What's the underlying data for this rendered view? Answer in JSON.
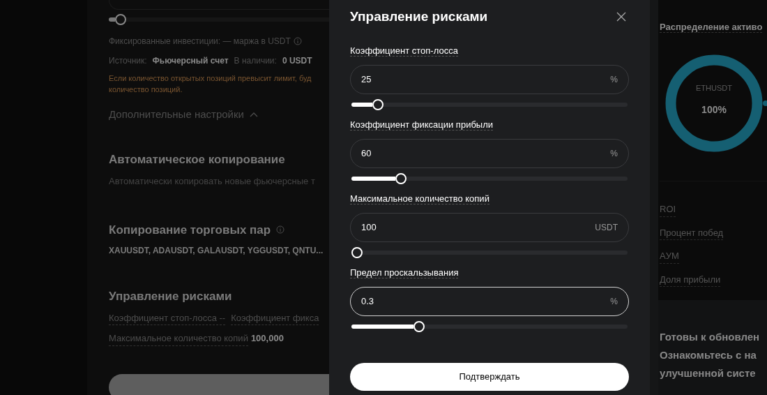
{
  "background": {
    "top_slider": {
      "level": 0.03
    },
    "investment_line": "Фиксированные инвестиции: — маржа в USDT",
    "source_label": "Источник:",
    "source_value": "Фьючерсный счет",
    "available_label": "В наличии:",
    "available_value": "0 USDT",
    "warning": "Если количество открытых позиций превысит лимит, буд\nколичество позиций.",
    "advanced_settings": {
      "label": "Дополнительные настройки",
      "expanded": true
    },
    "auto_copy": {
      "title": "Автоматическое копирование",
      "description": "Автоматически копировать новые фьючерсные т"
    },
    "pairs": {
      "title": "Копирование торговых пар",
      "value": "XAUUSDT, ADAUSDT, GALAUSDT, YGGUSDT, QNTU..."
    },
    "risk": {
      "title": "Управление рисками",
      "stop_loss": "Коэффициент стоп-лосса --",
      "take_profit": "Коэффициент фикса",
      "max_copies_label": "Максимальное количество копий",
      "max_copies_value": "100,000"
    }
  },
  "modal": {
    "title": "Управление рисками",
    "fields": [
      {
        "label": "Коэффициент стоп-лосса",
        "value": "25",
        "unit": "%",
        "focused": false,
        "level": 0.08
      },
      {
        "label": "Коэффициент фиксации прибыли",
        "value": "60",
        "unit": "%",
        "focused": false,
        "level": 0.165
      },
      {
        "label": "Максимальное количество копий",
        "value": "100",
        "unit": "USDT",
        "focused": false,
        "level": 0
      },
      {
        "label": "Предел проскальзывания",
        "value": "0.3",
        "unit": "%",
        "focused": true,
        "level": 0.235
      }
    ],
    "confirm": "Подтверждать"
  },
  "right": {
    "allocation_title": "Распределение активо",
    "center_label": "ETHUSDT",
    "center_value": "100%",
    "metrics": [
      "ROI",
      "Процент побед",
      "AУМ",
      "Доля прибыли"
    ],
    "promo": "Готовы к обновлен\nОзнакомьтесь с на\nулучшенной систе"
  }
}
